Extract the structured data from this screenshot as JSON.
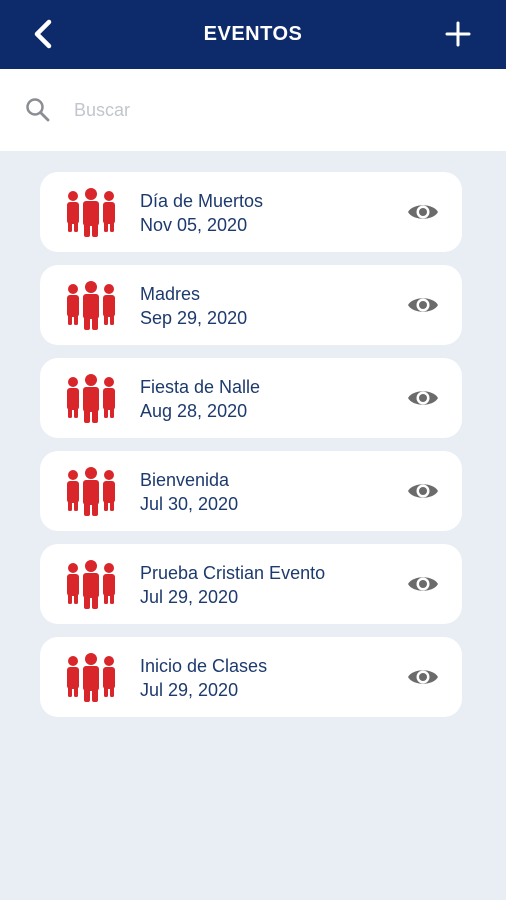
{
  "header": {
    "title": "EVENTOS",
    "back_icon": "chevron-left-icon",
    "add_icon": "plus-icon"
  },
  "search": {
    "placeholder": "Buscar",
    "value": "",
    "icon": "search-icon"
  },
  "colors": {
    "header_bg": "#0d2a6b",
    "icon_red": "#d9262a",
    "text_navy": "#1d3a6e",
    "eye_gray": "#6b6b6b",
    "page_bg": "#e9edf4"
  },
  "events": [
    {
      "name": "Día de Muertos",
      "date": "Nov 05, 2020",
      "icon": "people-group-icon"
    },
    {
      "name": "Madres",
      "date": "Sep 29, 2020",
      "icon": "people-group-icon"
    },
    {
      "name": "Fiesta de Nalle",
      "date": "Aug 28, 2020",
      "icon": "people-group-icon"
    },
    {
      "name": "Bienvenida",
      "date": "Jul 30, 2020",
      "icon": "people-group-icon"
    },
    {
      "name": "Prueba Cristian Evento",
      "date": "Jul 29, 2020",
      "icon": "people-group-icon"
    },
    {
      "name": "Inicio de Clases",
      "date": "Jul 29, 2020",
      "icon": "people-group-icon"
    }
  ]
}
